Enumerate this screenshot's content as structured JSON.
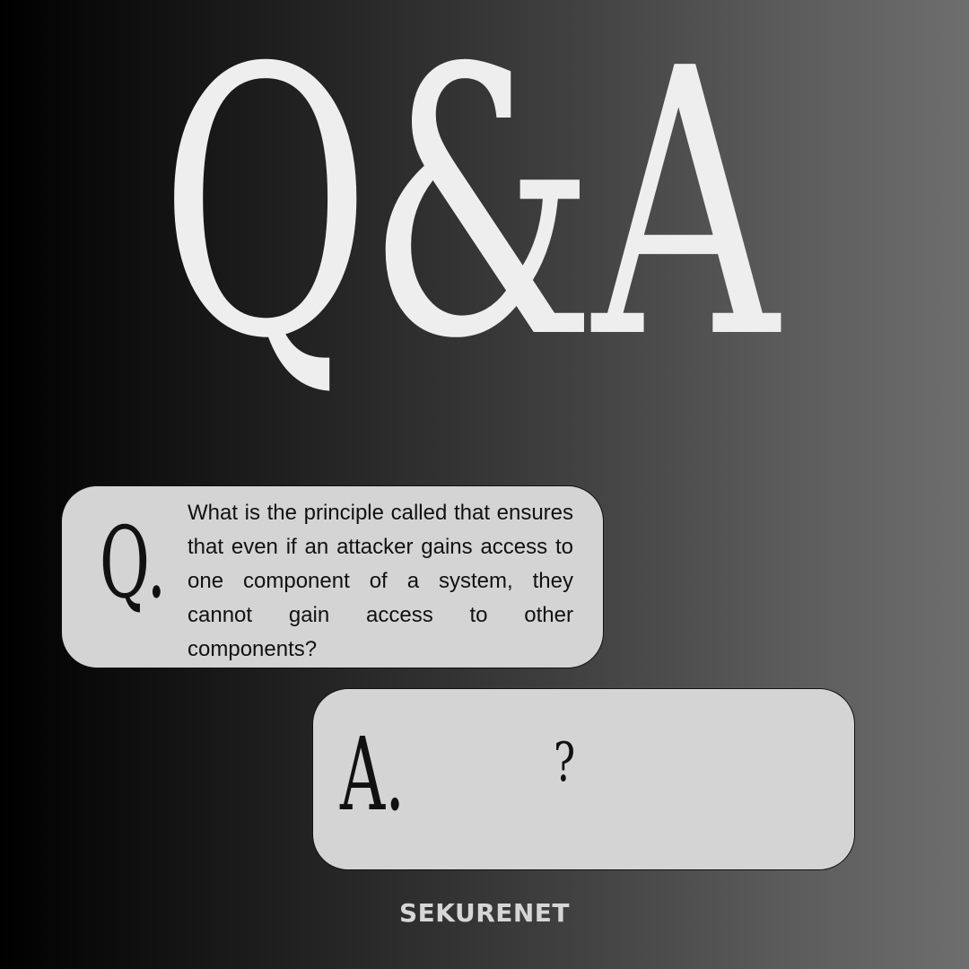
{
  "headline": "Q&A",
  "question": {
    "marker": "Q.",
    "text": "What is the principle called that ensures that even if an attacker gains access to one component of a system, they cannot gain access to other components?"
  },
  "answer": {
    "marker": "A.",
    "text": "?"
  },
  "brand": "SEKURENET",
  "colors": {
    "background_left": "#000000",
    "background_right": "#6e6e6e",
    "headline": "#eeeeee",
    "card": "#d4d4d4",
    "card_border": "#111111",
    "text": "#111111",
    "brand": "#d6d6d6"
  }
}
